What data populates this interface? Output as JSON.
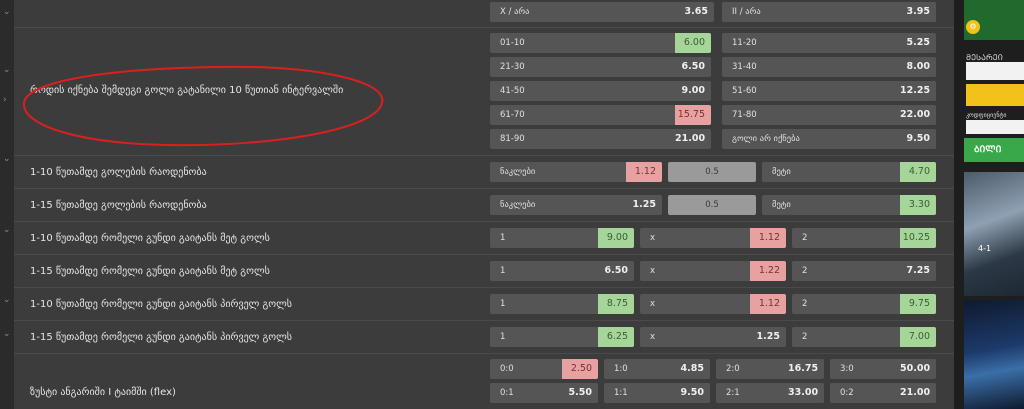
{
  "rows": [
    {
      "label": "",
      "cells": [
        {
          "name": "X / არა",
          "odd": "3.65",
          "style": ""
        },
        {
          "name": "II / არა",
          "odd": "3.95",
          "style": ""
        }
      ]
    },
    {
      "label": "როდის იქნება შემდეგი გოლი გატანილი 10 წუთიან ინტერვალში",
      "cells": [
        {
          "name": "01-10",
          "odd": "6.00",
          "style": "green"
        },
        {
          "name": "11-20",
          "odd": "5.25",
          "style": ""
        },
        {
          "name": "21-30",
          "odd": "6.50",
          "style": ""
        },
        {
          "name": "31-40",
          "odd": "8.00",
          "style": ""
        },
        {
          "name": "41-50",
          "odd": "9.00",
          "style": ""
        },
        {
          "name": "51-60",
          "odd": "12.25",
          "style": ""
        },
        {
          "name": "61-70",
          "odd": "15.75",
          "style": "red"
        },
        {
          "name": "71-80",
          "odd": "22.00",
          "style": ""
        },
        {
          "name": "81-90",
          "odd": "21.00",
          "style": ""
        },
        {
          "name": "გოლი არ იქნება",
          "odd": "9.50",
          "style": ""
        }
      ]
    },
    {
      "label": "1-10 წუთამდე გოლების რაოდენობა",
      "under": {
        "name": "ნაკლები",
        "odd": "1.12",
        "style": "red"
      },
      "line": "0.5",
      "over": {
        "name": "მეტი",
        "odd": "4.70",
        "style": "green"
      }
    },
    {
      "label": "1-15 წუთამდე გოლების რაოდენობა",
      "under": {
        "name": "ნაკლები",
        "odd": "1.25",
        "style": ""
      },
      "line": "0.5",
      "over": {
        "name": "მეტი",
        "odd": "3.30",
        "style": "green"
      }
    },
    {
      "label": "1-10 წუთამდე რომელი გუნდი გაიტანს მეტ გოლს",
      "three": [
        {
          "name": "1",
          "odd": "9.00",
          "style": "green"
        },
        {
          "name": "x",
          "odd": "1.12",
          "style": "red"
        },
        {
          "name": "2",
          "odd": "10.25",
          "style": "green"
        }
      ]
    },
    {
      "label": "1-15 წუთამდე რომელი გუნდი გაიტანს მეტ გოლს",
      "three": [
        {
          "name": "1",
          "odd": "6.50",
          "style": ""
        },
        {
          "name": "x",
          "odd": "1.22",
          "style": "red"
        },
        {
          "name": "2",
          "odd": "7.25",
          "style": ""
        }
      ]
    },
    {
      "label": "1-10 წუთამდე რომელი გუნდი გაიტანს პირველ გოლს",
      "three": [
        {
          "name": "1",
          "odd": "8.75",
          "style": "green"
        },
        {
          "name": "x",
          "odd": "1.12",
          "style": "red"
        },
        {
          "name": "2",
          "odd": "9.75",
          "style": "green"
        }
      ]
    },
    {
      "label": "1-15 წუთამდე რომელი გუნდი გაიტანს პირველ გოლს",
      "three": [
        {
          "name": "1",
          "odd": "6.25",
          "style": "green"
        },
        {
          "name": "x",
          "odd": "1.25",
          "style": ""
        },
        {
          "name": "2",
          "odd": "7.00",
          "style": "green"
        }
      ]
    },
    {
      "label": "ზუსტი ანგარიში I ტაიმში (flex)",
      "four": [
        {
          "name": "0:0",
          "odd": "2.50",
          "style": "red"
        },
        {
          "name": "1:0",
          "odd": "4.85",
          "style": ""
        },
        {
          "name": "2:0",
          "odd": "16.75",
          "style": ""
        },
        {
          "name": "3:0",
          "odd": "50.00",
          "style": ""
        },
        {
          "name": "0:1",
          "odd": "5.50",
          "style": ""
        },
        {
          "name": "1:1",
          "odd": "9.50",
          "style": ""
        },
        {
          "name": "2:1",
          "odd": "33.00",
          "style": ""
        },
        {
          "name": "0:2",
          "odd": "21.00",
          "style": ""
        }
      ]
    }
  ],
  "sidebar": {
    "promo_label": "ᲛᲔᲡᲐᲠᲔᲘ",
    "coupon_label": "კოდფიციენტი",
    "ticket_button": "ᲑᲘᲚᲘ",
    "score_text": "4-1"
  },
  "colors": {
    "odd_up": "#a6d59a",
    "odd_down": "#e8a1a1",
    "annotation": "#d9201e"
  }
}
